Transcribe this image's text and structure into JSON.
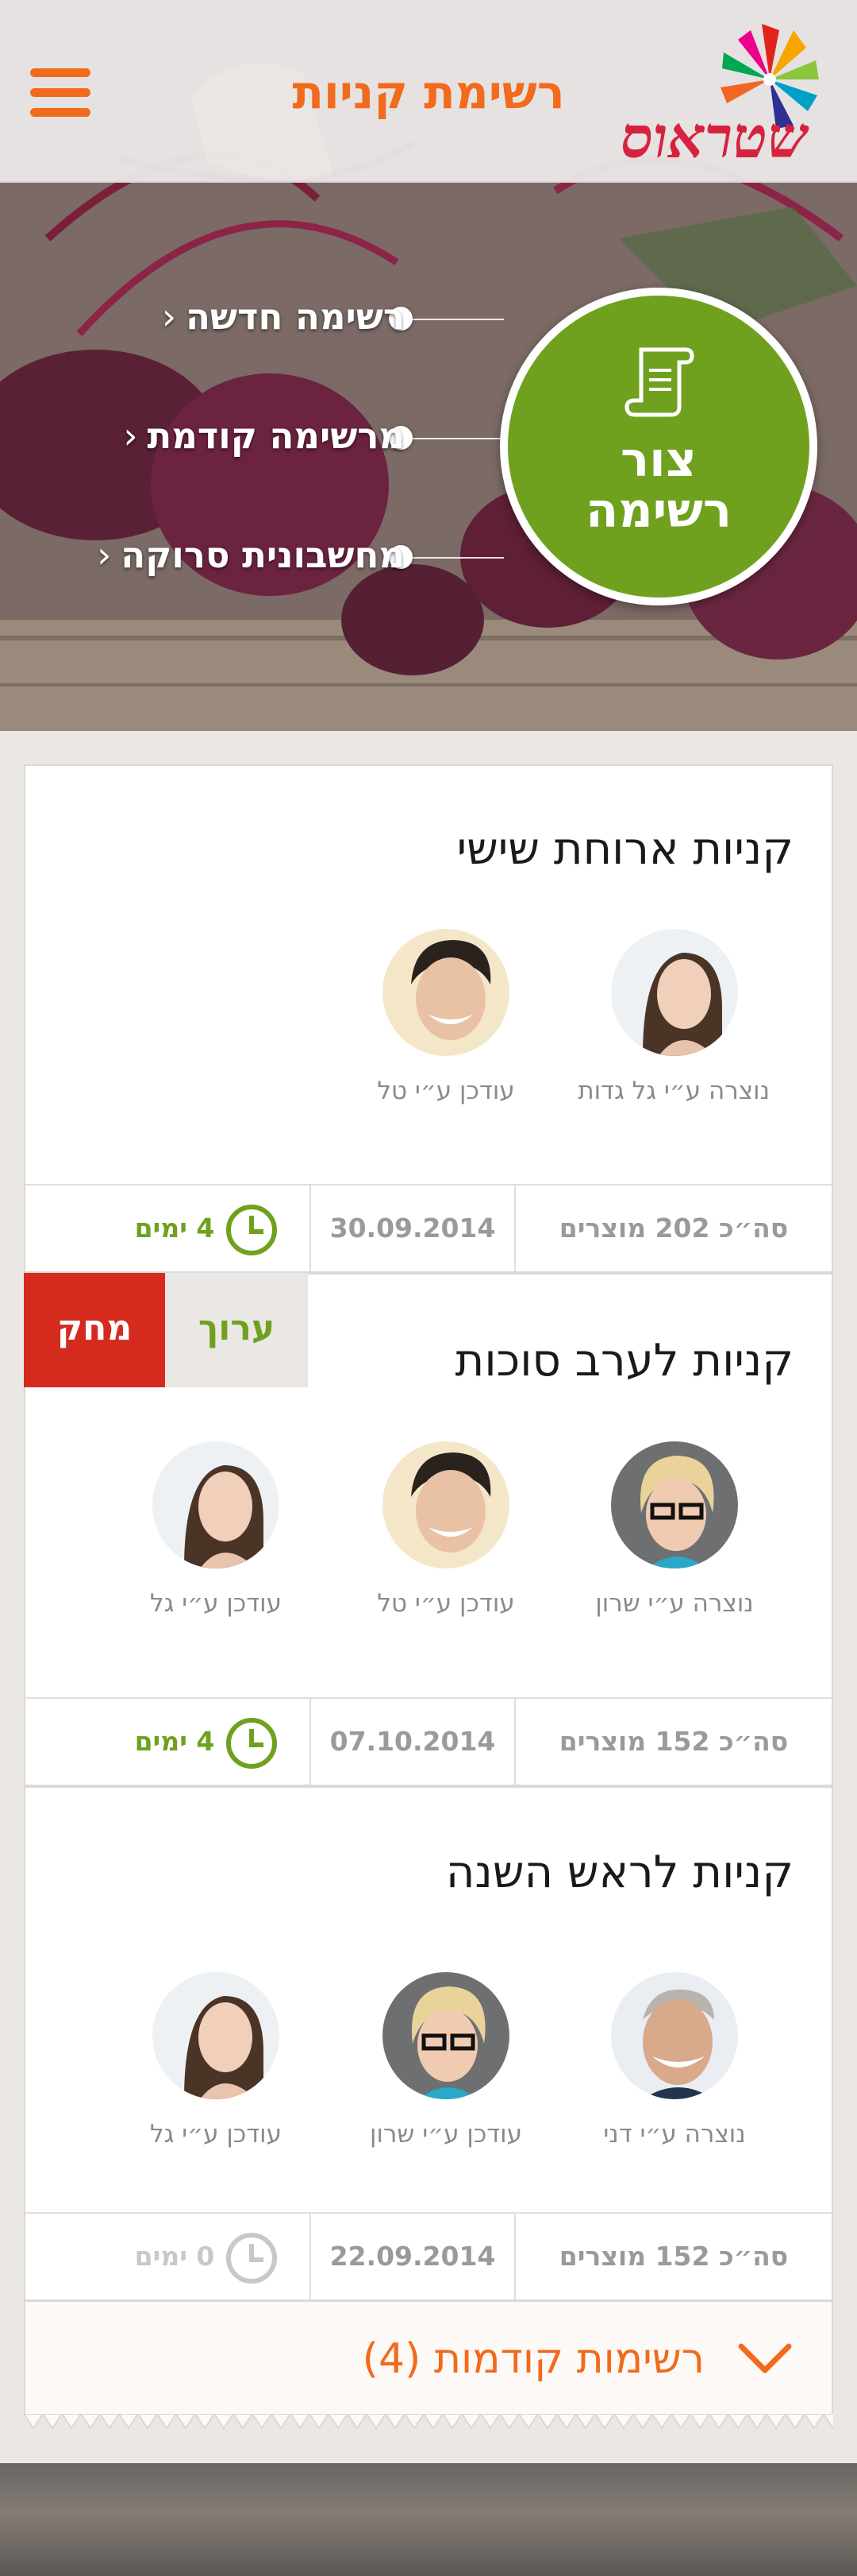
{
  "header": {
    "title": "רשימת קניות",
    "logo_text": "שטראוס"
  },
  "hero": {
    "links": [
      {
        "label": "רשימה חדשה"
      },
      {
        "label": "מרשימה קודמת"
      },
      {
        "label": "מחשבונית סרוקה"
      }
    ],
    "chevron": "‹",
    "create_button": {
      "line1": "צור",
      "line2": "רשימה"
    }
  },
  "lists": [
    {
      "title": "קניות ארוחת שישי",
      "people": [
        {
          "caption": "נוצרה ע״י גל גדות",
          "avatar": "woman-brunette"
        },
        {
          "caption": "עודכן ע״י טל",
          "avatar": "man-smiling"
        }
      ],
      "total": "סה״כ 202 מוצרים",
      "date": "30.09.2014",
      "days": "4 ימים"
    },
    {
      "title": "קניות לערב סוכות",
      "edit_label": "ערוך",
      "delete_label": "מחק",
      "people": [
        {
          "caption": "נוצרה ע״י שרון",
          "avatar": "woman-glasses"
        },
        {
          "caption": "עודכן ע״י טל",
          "avatar": "man-smiling"
        },
        {
          "caption": "עודכן ע״י גל",
          "avatar": "woman-brunette"
        }
      ],
      "total": "סה״כ 152 מוצרים",
      "date": "07.10.2014",
      "days": "4 ימים"
    },
    {
      "title": "קניות לראש השנה",
      "people": [
        {
          "caption": "נוצרה ע״י דני",
          "avatar": "man-older"
        },
        {
          "caption": "עודכן ע״י שרון",
          "avatar": "woman-glasses"
        },
        {
          "caption": "עודכן ע״י גל",
          "avatar": "woman-brunette"
        }
      ],
      "total": "סה״כ 152 מוצרים",
      "date": "22.09.2014",
      "days": "0 ימים"
    }
  ],
  "previous_lists": {
    "label": "רשימות קודמות (4)"
  },
  "colors": {
    "orange": "#f26a1b",
    "green": "#6fa11f",
    "red": "#d52b1e"
  }
}
